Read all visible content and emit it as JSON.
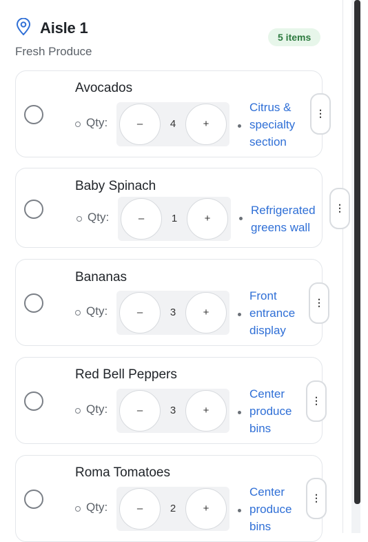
{
  "aisle": {
    "title": "Aisle 1",
    "subtitle": "Fresh Produce",
    "count_label": "5 items",
    "icon": "location-pin-icon"
  },
  "items": [
    {
      "name": "Avocados",
      "qty_label": "Qty:",
      "qty": "4",
      "minus": "–",
      "plus": "+",
      "location": [
        "Citrus &",
        "specialty",
        "section"
      ],
      "menu": "⋮"
    },
    {
      "name": "Baby Spinach",
      "qty_label": "Qty:",
      "qty": "1",
      "minus": "–",
      "plus": "+",
      "location": [
        "Refrigerated",
        "greens wall"
      ],
      "menu": "⋮"
    },
    {
      "name": "Bananas",
      "qty_label": "Qty:",
      "qty": "3",
      "minus": "–",
      "plus": "+",
      "location": [
        "Front",
        "entrance",
        "display"
      ],
      "menu": "⋮"
    },
    {
      "name": "Red Bell Peppers",
      "qty_label": "Qty:",
      "qty": "3",
      "minus": "–",
      "plus": "+",
      "location": [
        "Center",
        "produce",
        "bins"
      ],
      "menu": "⋮"
    },
    {
      "name": "Roma Tomatoes",
      "qty_label": "Qty:",
      "qty": "2",
      "minus": "–",
      "plus": "+",
      "location": [
        "Center",
        "produce",
        "bins"
      ],
      "menu": "⋮"
    }
  ],
  "colors": {
    "accent": "#2f6fd6",
    "badge_bg": "#e7f6ea",
    "badge_text": "#2d7a3f"
  }
}
